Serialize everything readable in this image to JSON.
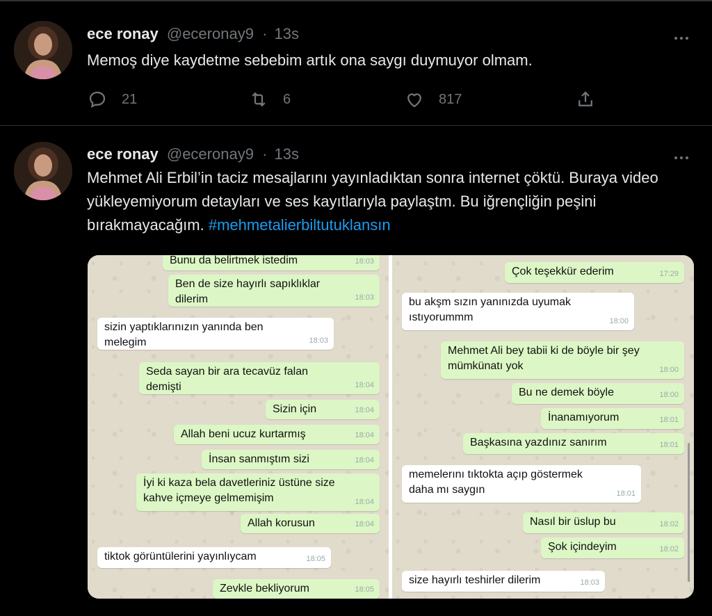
{
  "tweets": [
    {
      "name": "ece ronay",
      "handle": "@eceronay9",
      "sep": "·",
      "time": "13s",
      "text": "Memoş diye kaydetme sebebim artık ona saygı duymuyor olmam.",
      "reply_count": "21",
      "retweet_count": "6",
      "like_count": "817"
    },
    {
      "name": "ece ronay",
      "handle": "@eceronay9",
      "sep": "·",
      "time": "13s",
      "text": "Mehmet Ali Erbil’in taciz mesajlarını yayınladıktan sonra internet çöktü. Buraya video yükleyemiyorum detayları ve ses kayıtlarıyla paylaştm. Bu iğrençliğin peşini bırakmayacağım.",
      "hashtag": "#mehmetalierbiltutuklansın"
    }
  ],
  "chat_left": [
    {
      "text": "Bunu da belirtmek istedim",
      "time": "18:03"
    },
    {
      "text": "Ben de size hayırlı sapıklıklar dilerim",
      "time": "18:03"
    },
    {
      "text": "sizin yaptıklarınızın yanında ben melegim",
      "time": "18:03"
    },
    {
      "text": "Seda sayan bir ara tecavüz falan demişti",
      "time": "18:04"
    },
    {
      "text": "Sizin için",
      "time": "18:04"
    },
    {
      "text": "Allah beni ucuz kurtarmış",
      "time": "18:04"
    },
    {
      "text": "İnsan sanmıştım sizi",
      "time": "18:04"
    },
    {
      "text": "İyi ki kaza bela davetleriniz üstüne size kahve içmeye gelmemişim",
      "time": "18:04"
    },
    {
      "text": "Allah korusun",
      "time": "18:04"
    },
    {
      "text": "tiktok görüntülerini yayınlıycam",
      "time": "18:05"
    },
    {
      "text": "Zevkle bekliyorum",
      "time": "18:05"
    }
  ],
  "chat_right": [
    {
      "text": "Çok teşekkür ederim",
      "time": "17:29"
    },
    {
      "text": "bu akşm sızın yanınızda uyumak ıstıyorummm",
      "time": "18:00"
    },
    {
      "text": "Mehmet Ali bey tabii ki de böyle bir şey mümkünatı yok",
      "time": "18:00"
    },
    {
      "text": "Bu ne demek böyle",
      "time": "18:00"
    },
    {
      "text": "İnanamıyorum",
      "time": "18:01"
    },
    {
      "text": "Başkasına yazdınız sanırım",
      "time": "18:01"
    },
    {
      "text": "memelerını tıktokta açıp göstermek daha mı saygın",
      "time": "18:01"
    },
    {
      "text": "Nasıl bir üslup bu",
      "time": "18:02"
    },
    {
      "text": "Şok içindeyim",
      "time": "18:02"
    },
    {
      "text": "size hayırlı teshirler dilerim",
      "time": "18:03"
    }
  ],
  "icons": [
    "reply-icon",
    "retweet-icon",
    "like-icon",
    "share-icon",
    "more-icon"
  ],
  "colors": {
    "background": "#000000",
    "link": "#1d9bf0",
    "muted": "#71767b",
    "outgoing_bubble": "#dcf7c5"
  }
}
